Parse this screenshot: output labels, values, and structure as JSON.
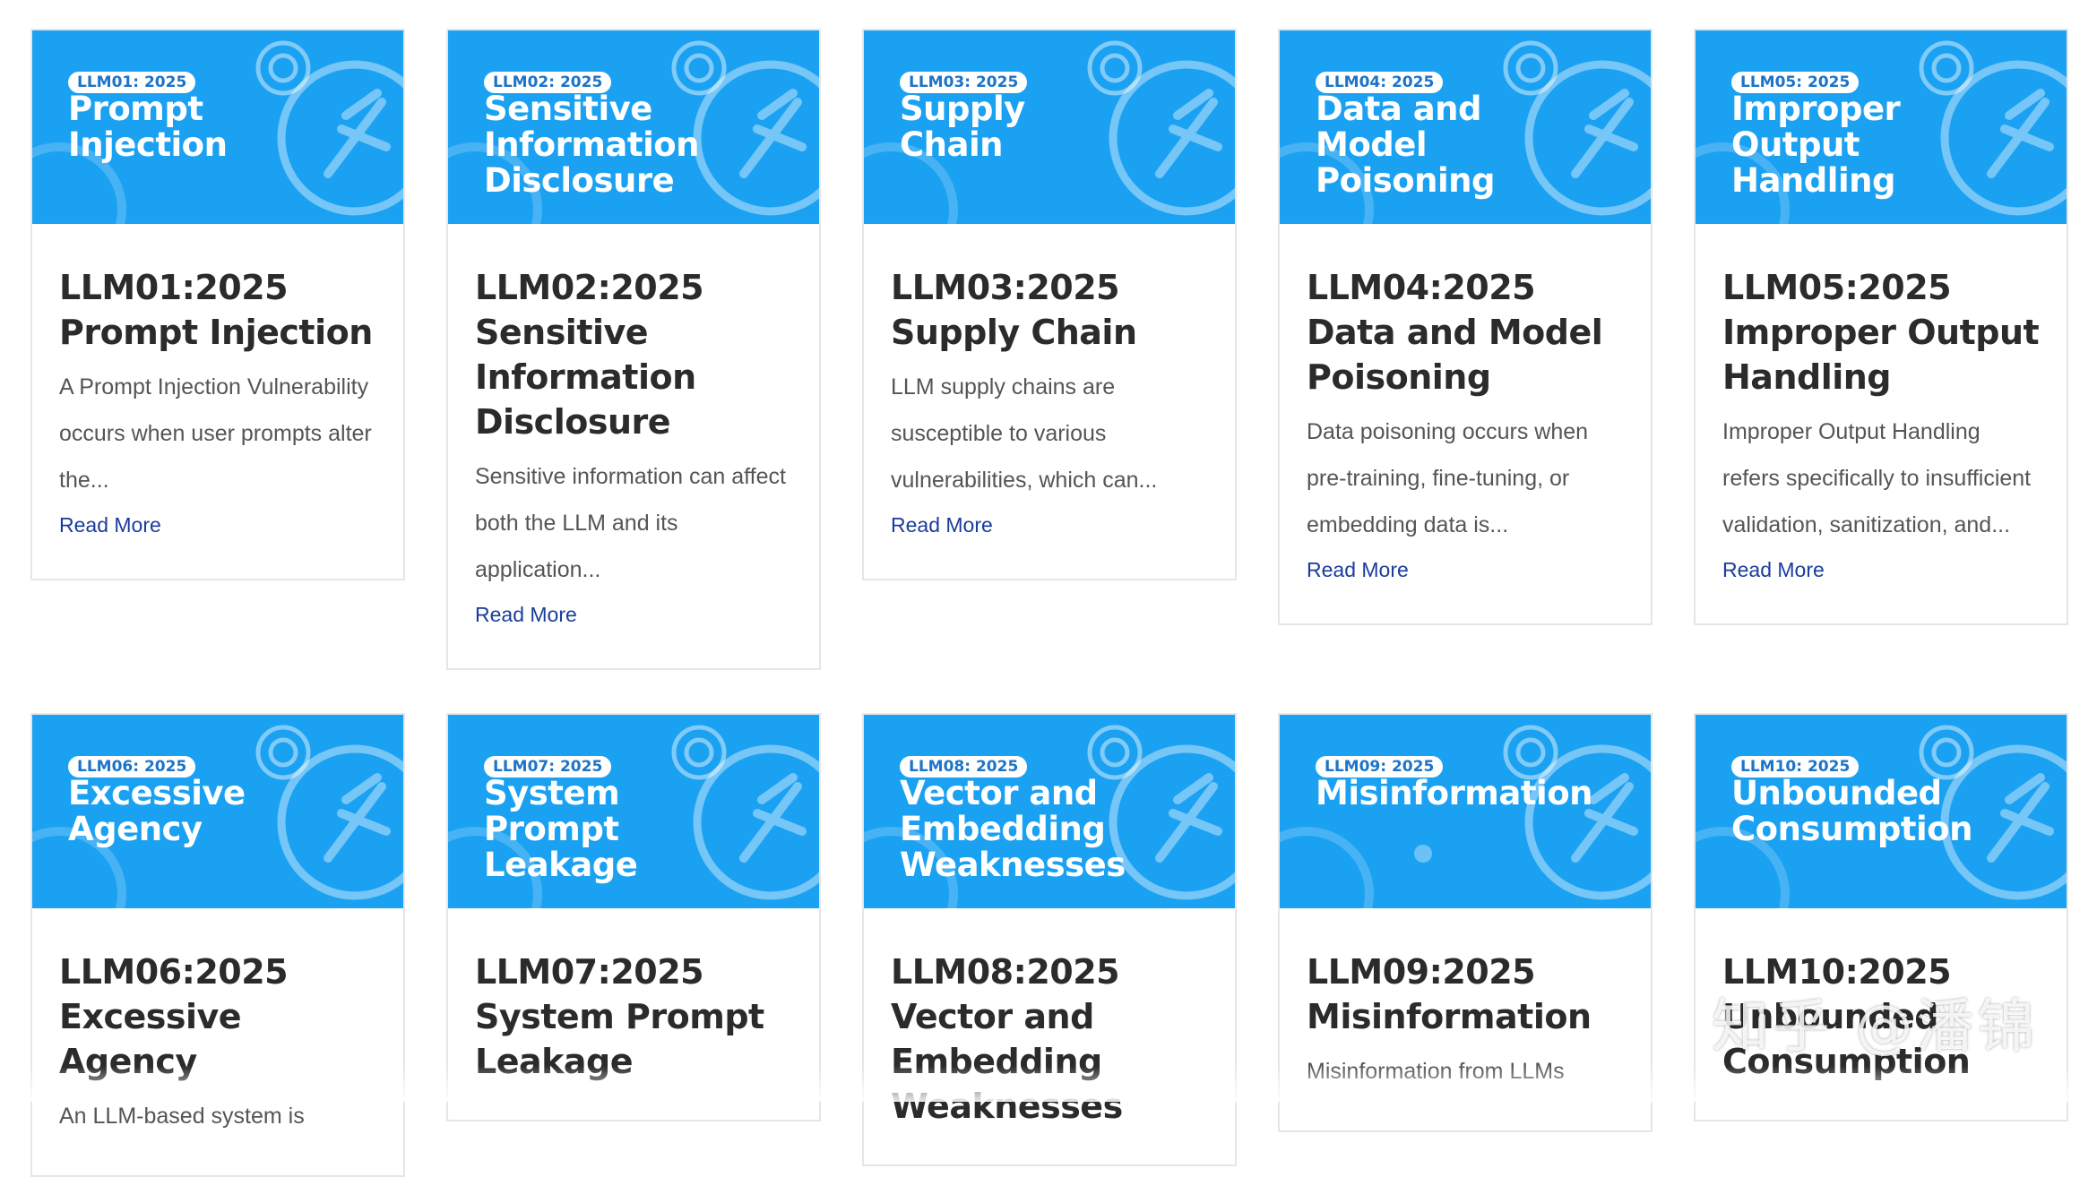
{
  "cards": [
    {
      "badge": "LLM01: 2025",
      "banner": "Prompt Injection",
      "title": "LLM01:2025 Prompt Injection",
      "desc": "A Prompt Injection Vulnerability occurs when user prompts alter the...",
      "more": "Read More"
    },
    {
      "badge": "LLM02: 2025",
      "banner": "Sensitive Information Disclosure",
      "title": "LLM02:2025 Sensitive Information Disclosure",
      "desc": "Sensitive information can affect both the LLM and its application...",
      "more": "Read More"
    },
    {
      "badge": "LLM03: 2025",
      "banner": "Supply Chain",
      "title": "LLM03:2025 Supply Chain",
      "desc": "LLM supply chains are susceptible to various vulnerabilities, which can...",
      "more": "Read More"
    },
    {
      "badge": "LLM04: 2025",
      "banner": "Data and Model Poisoning",
      "title": "LLM04:2025 Data and Model Poisoning",
      "desc": "Data poisoning occurs when pre-training, fine-tuning, or embedding data is...",
      "more": "Read More"
    },
    {
      "badge": "LLM05: 2025",
      "banner": "Improper Output Handling",
      "title": "LLM05:2025 Improper Output Handling",
      "desc": "Improper Output Handling refers specifically to insufficient validation, sanitization, and...",
      "more": "Read More"
    },
    {
      "badge": "LLM06: 2025",
      "banner": "Excessive Agency",
      "title": "LLM06:2025 Excessive Agency",
      "desc": "An LLM-based system is",
      "more": ""
    },
    {
      "badge": "LLM07: 2025",
      "banner": "System Prompt Leakage",
      "title": "LLM07:2025 System Prompt Leakage",
      "desc": "",
      "more": ""
    },
    {
      "badge": "LLM08: 2025",
      "banner": "Vector and Embedding Weaknesses",
      "title": "LLM08:2025 Vector and Embedding Weaknesses",
      "desc": "",
      "more": ""
    },
    {
      "badge": "LLM09: 2025",
      "banner": "Misinformation",
      "title": "LLM09:2025 Misinformation",
      "desc": "Misinformation from LLMs",
      "more": ""
    },
    {
      "badge": "LLM10: 2025",
      "banner": "Unbounded Consumption",
      "title": "LLM10:2025 Unbounded Consumption",
      "desc": "",
      "more": ""
    }
  ],
  "watermark": "知乎 @潘锦"
}
